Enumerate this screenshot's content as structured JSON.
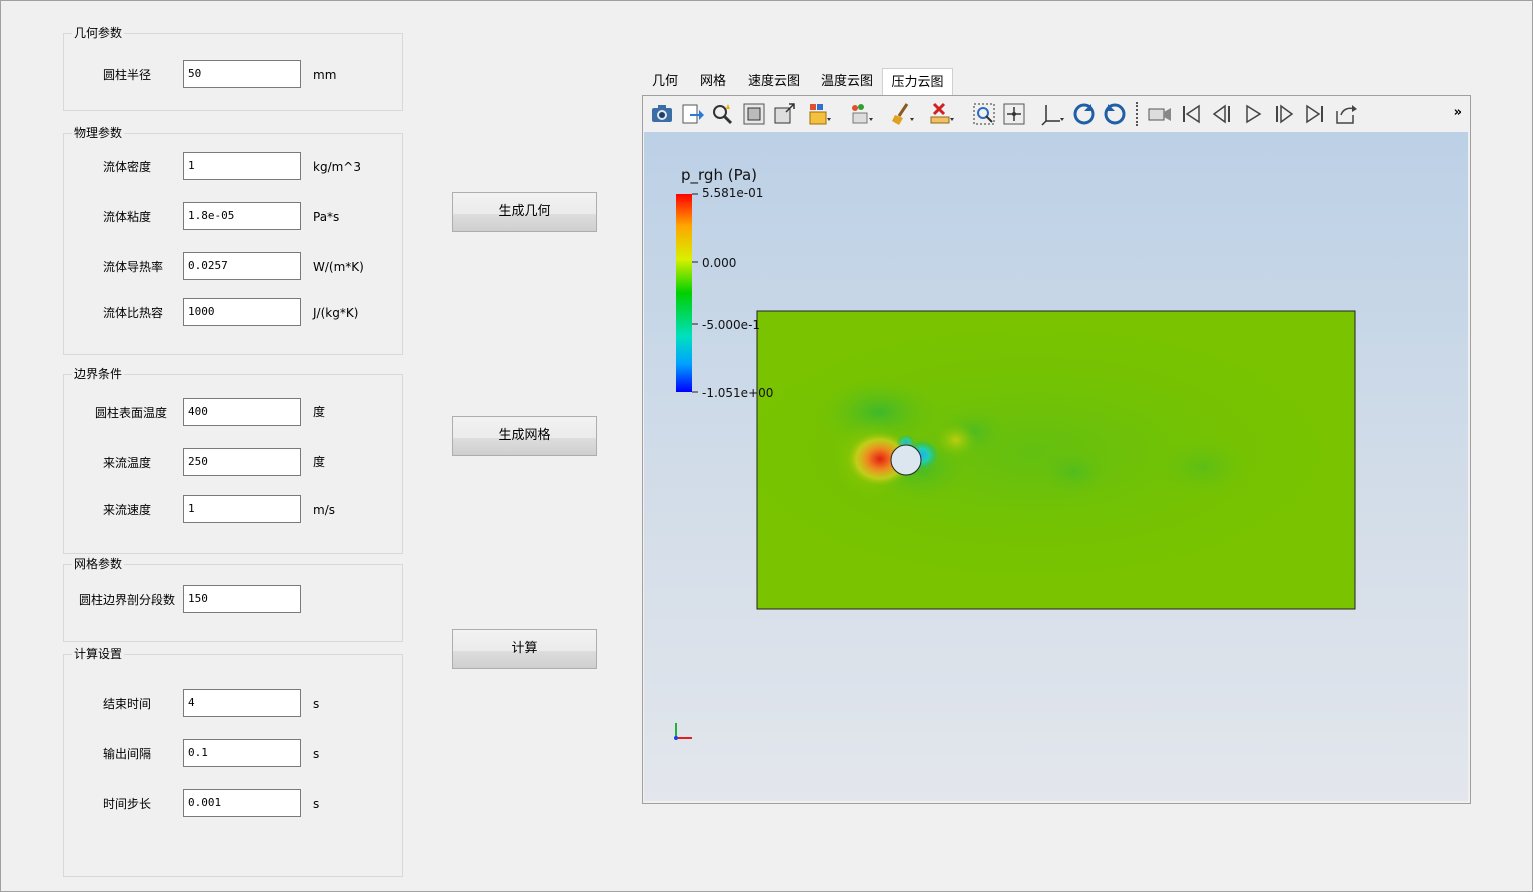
{
  "geometry": {
    "title": "几何参数",
    "radius_label": "圆柱半径",
    "radius_value": "50",
    "radius_unit": "mm"
  },
  "physics": {
    "title": "物理参数",
    "density_label": "流体密度",
    "density_value": "1",
    "density_unit": "kg/m^3",
    "viscosity_label": "流体粘度",
    "viscosity_value": "1.8e-05",
    "viscosity_unit": "Pa*s",
    "conductivity_label": "流体导热率",
    "conductivity_value": "0.0257",
    "conductivity_unit": "W/(m*K)",
    "heat_capacity_label": "流体比热容",
    "heat_capacity_value": "1000",
    "heat_capacity_unit": "J/(kg*K)"
  },
  "boundary": {
    "title": "边界条件",
    "surface_temp_label": "圆柱表面温度",
    "surface_temp_value": "400",
    "surface_temp_unit": "度",
    "inflow_temp_label": "来流温度",
    "inflow_temp_value": "250",
    "inflow_temp_unit": "度",
    "inflow_speed_label": "来流速度",
    "inflow_speed_value": "1",
    "inflow_speed_unit": "m/s"
  },
  "mesh": {
    "title": "网格参数",
    "segments_label": "圆柱边界剖分段数",
    "segments_value": "150"
  },
  "solver": {
    "title": "计算设置",
    "end_time_label": "结束时间",
    "end_time_value": "4",
    "end_time_unit": "s",
    "output_interval_label": "输出间隔",
    "output_interval_value": "0.1",
    "output_interval_unit": "s",
    "time_step_label": "时间步长",
    "time_step_value": "0.001",
    "time_step_unit": "s"
  },
  "actions": {
    "generate_geometry": "生成几何",
    "generate_mesh": "生成网格",
    "compute": "计算"
  },
  "tabs": [
    "几何",
    "网格",
    "速度云图",
    "温度云图",
    "压力云图"
  ],
  "active_tab": "压力云图",
  "toolbar": {
    "icons": [
      "camera-icon",
      "export-icon",
      "find-data-icon",
      "reset-camera-icon",
      "zoom-to-data-icon",
      "toggle-block-icon",
      "toggle-points-icon",
      "clear-icon",
      "ruler-icon",
      "zoom-box-icon",
      "pick-center-icon",
      "axes-icon",
      "rotate-cw-icon",
      "rotate-ccw-icon",
      "camera-link-icon",
      "first-frame-icon",
      "prev-frame-icon",
      "play-icon",
      "next-frame-icon",
      "last-frame-icon",
      "loop-icon"
    ],
    "more": "»"
  },
  "legend": {
    "title": "p_rgh (Pa)",
    "max_label": "5.581e-01",
    "zero_label": "0.000",
    "mid_label": "-5.000e-1",
    "min_label": "-1.051e+00",
    "colors": [
      "#ff0000",
      "#ffa500",
      "#ffff00",
      "#00c800",
      "#00ffff",
      "#0000ff"
    ]
  },
  "colors": {
    "field_base": "#79c300",
    "high_pressure": "#e83010",
    "low_pressure": "#30c0e0"
  }
}
